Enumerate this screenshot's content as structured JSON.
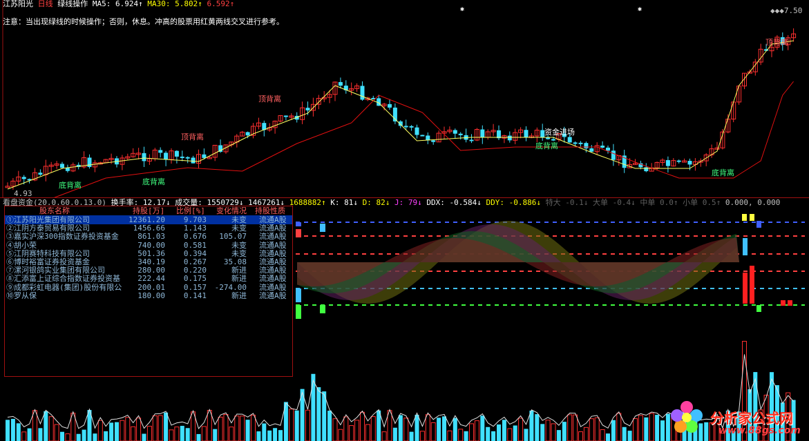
{
  "header": {
    "stock_name": "江苏阳光",
    "period": "日线",
    "formula": "绿线操作",
    "ma5_label": "MA5: ",
    "ma5_value": "6.924↑",
    "ma30_label": "MA30: ",
    "ma30_value": "5.802↑",
    "ma_extra": "6.592↑",
    "note": "注意：当出现绿线的时候操作；否则，休息。冲高的股票用红黄两线交叉进行参考。",
    "price_high": "7.50",
    "price_low": "4.93"
  },
  "annotations": {
    "top_div_1": "顶背离",
    "top_div_2": "顶背离",
    "top_div_3": "顶背离",
    "bottom_div_1": "底背离",
    "bottom_div_2": "底背离",
    "bottom_div_3": "底背离",
    "bottom_div_4": "底背离",
    "capital_in": "资金进场"
  },
  "indicator_bar": {
    "pan_label": "看盘资金(20.0.60.0.13.0)",
    "turnover_label": "换手率: ",
    "turnover_value": "12.17↓",
    "volume_label": "成交量: ",
    "volume_value": "1550729↓",
    "vol2": "1467261↓",
    "vol3": "1688882↑",
    "k": "K: 81↓",
    "d": "D: 82↓",
    "j": "J: 79↓",
    "ddx": "DDX: -0.584↓",
    "ddy": "DDY: -0.886↓",
    "tedа": "特大 -0.1↓",
    "da": "大单 -0.4↓",
    "zhong": "中单 0.0↑",
    "xiao": "小单 0.5↑",
    "tail": "0.000, 0.000"
  },
  "table": {
    "headers": [
      "股东名称",
      "持股[万]",
      "比例[%]",
      "变化情况",
      "持股性质"
    ],
    "rows": [
      [
        "①江苏阳光集团有限公司",
        "12361.20",
        "9.703",
        "未变",
        "流通A股"
      ],
      [
        "②江阴方泰贸易有限公司",
        "1456.66",
        "1.143",
        "未变",
        "流通A股"
      ],
      [
        "③嘉实沪深300指数证券投资基金",
        "861.03",
        "0.676",
        "105.07",
        "流通A股"
      ],
      [
        "④胡小荣",
        "740.00",
        "0.581",
        "未变",
        "流通A股"
      ],
      [
        "⑤江阴赛特科技有限公司",
        "501.36",
        "0.394",
        "未变",
        "流通A股"
      ],
      [
        "⑥博时裕富证券投资基金",
        "340.19",
        "0.267",
        "35.08",
        "流通A股"
      ],
      [
        "⑦漯河银鸽实业集团有限公司",
        "280.00",
        "0.220",
        "新进",
        "流通A股"
      ],
      [
        "⑧汇添富上证综合指数证券投资基",
        "222.44",
        "0.175",
        "新进",
        "流通A股"
      ],
      [
        "⑨成都彩虹电器(集团)股份有限公",
        "200.01",
        "0.157",
        "-274.00",
        "流通A股"
      ],
      [
        "⑩罗从保",
        "180.00",
        "0.141",
        "新进",
        "流通A股"
      ]
    ]
  },
  "watermark": {
    "title": "分析家公式网",
    "url": "www.88gs.com"
  },
  "colors": {
    "up": "#ff3030",
    "down": "#40e0ff",
    "ma_yellow": "#ffff60",
    "ma_red": "#e01010",
    "green_label": "#40ff80",
    "red_label": "#ff6060"
  }
}
